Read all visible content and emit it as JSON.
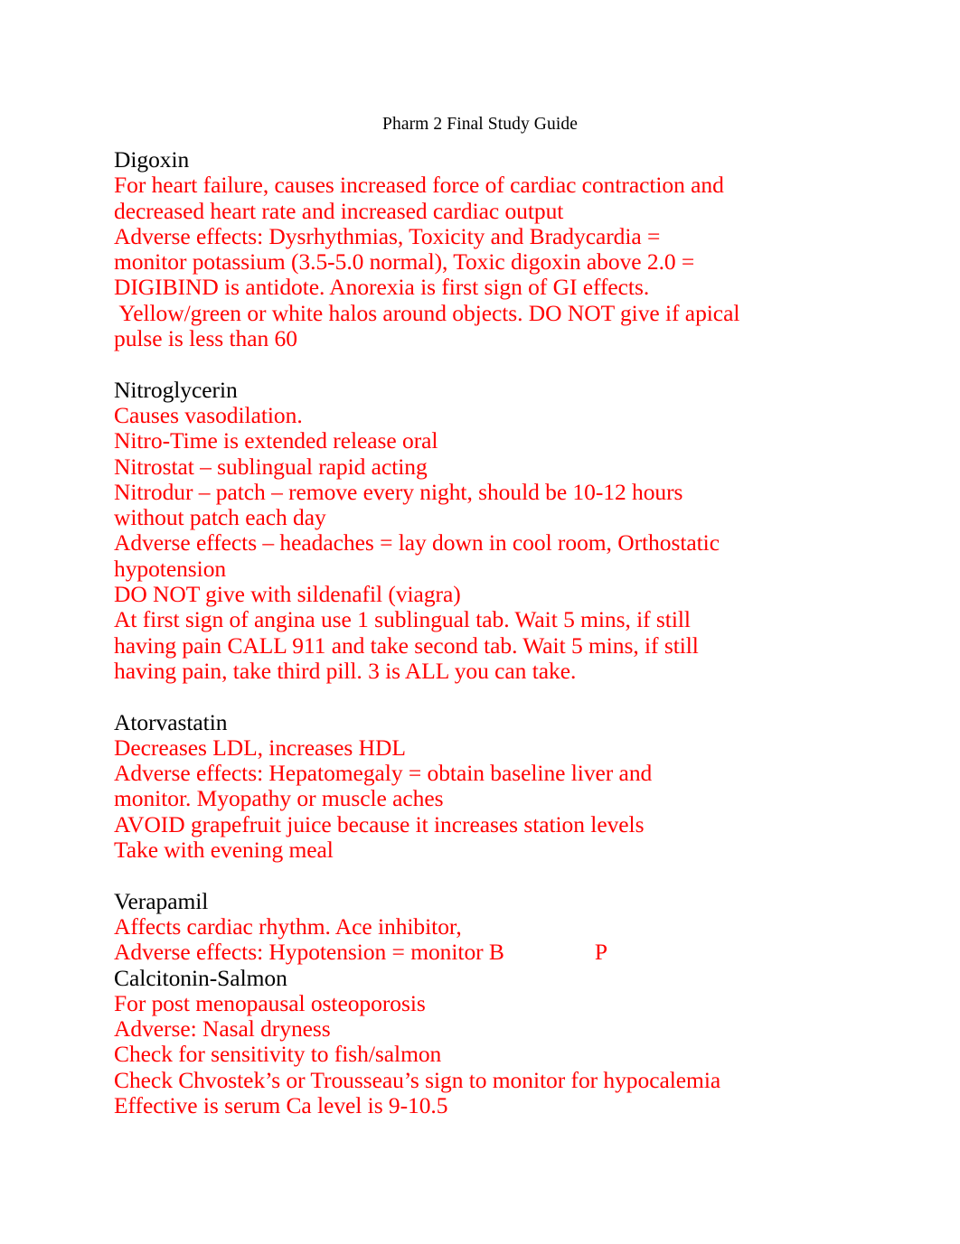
{
  "document": {
    "title": "Pharm 2 Final Study Guide",
    "colors": {
      "heading": "#000000",
      "body": "#FF0000",
      "background": "#FFFFFF"
    },
    "sections": [
      {
        "heading": "Digoxin",
        "lines": [
          "For heart failure, causes increased force of cardiac contraction and",
          "decreased heart rate and increased cardiac output",
          "Adverse effects: Dysrhythmias, Toxicity and Bradycardia =",
          "monitor potassium (3.5-5.0 normal), Toxic digoxin above 2.0 =",
          "DIGIBIND is antidote. Anorexia is first sign of GI effects.",
          " Yellow/green or white halos around objects. DO NOT give if apical",
          "pulse is less than 60"
        ]
      },
      {
        "heading": "Nitroglycerin",
        "lines": [
          "Causes vasodilation.",
          "Nitro-Time is extended release oral",
          "Nitrostat – sublingual rapid acting",
          "Nitrodur – patch – remove every night, should be 10-12 hours",
          "without patch each day",
          "Adverse effects – headaches = lay down in cool room, Orthostatic",
          "hypotension",
          "DO NOT give with sildenafil (viagra)",
          "At first sign of angina use 1 sublingual tab. Wait 5 mins, if still",
          "having pain CALL 911 and take second tab. Wait 5 mins, if still",
          "having pain, take third pill. 3 is ALL you can take."
        ]
      },
      {
        "heading": "Atorvastatin",
        "lines": [
          "Decreases LDL, increases HDL",
          "Adverse effects: Hepatomegaly = obtain baseline liver and",
          "monitor. Myopathy or muscle aches",
          "AVOID grapefruit juice because it increases station levels",
          "Take with evening meal"
        ]
      },
      {
        "heading": "Verapamil",
        "lines": [
          "Affects cardiac rhythm. Ace inhibitor,",
          "Adverse effects: Hypotension = monitor B"
        ],
        "trailing_line_before_gap": "Adverse effects: Hypotension = monitor B",
        "trailing_line_after_gap": "P"
      },
      {
        "heading": "Calcitonin-Salmon",
        "lines": [
          "For post menopausal osteoporosis",
          "Adverse: Nasal dryness",
          "Check for sensitivity to fish/salmon",
          "Check Chvostek’s or Trousseau’s sign to monitor for hypocalemia",
          "Effective is serum Ca level is 9-10.5"
        ]
      }
    ]
  }
}
